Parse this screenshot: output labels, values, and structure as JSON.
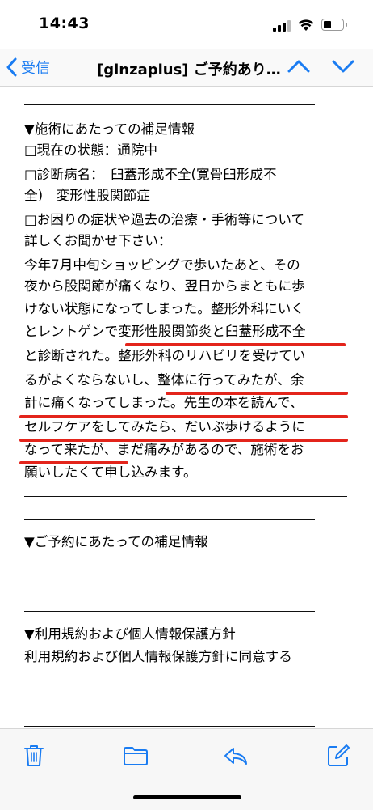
{
  "status_bar": {
    "time": "14:43"
  },
  "nav": {
    "back_label": "受信",
    "title": "[ginzaplus] ご予約あり…"
  },
  "email": {
    "lines": [
      "▼施術にあたっての補足情報",
      "□現在の状態：通院中",
      "□診断病名：　臼蓋形成不全(寛骨臼形成不",
      "全)　変形性股関節症",
      "□お困りの症状や過去の治療・手術等について",
      "詳しくお聞かせ下さい：",
      "今年7月中旬ショッピングで歩いたあと、その",
      "夜から股関節が痛くなり、翌日からまともに歩",
      "けない状態になってしまった。整形外科にいく",
      "とレントゲンで変形性股関節炎と臼蓋形成不全",
      "と診断された。整形外科のリハビリを受けてい",
      "るがよくならないし、整体に行ってみたが、余",
      "計に痛くなってしまった。先生の本を読んで、",
      "セルフケアをしてみたら、だいぶ歩けるように",
      "なって来たが、まだ痛みがあるので、施術をお",
      "願いしたくて申し込みます。",
      "▼ご予約にあたっての補足情報",
      "▼利用規約および個人情報保護方針",
      "利用規約および個人情報保護方針に同意する"
    ]
  },
  "colors": {
    "accent": "#1a7cf2",
    "underline": "#e3241b"
  },
  "icons": [
    "back-chevron-icon",
    "up-arrow-icon",
    "down-arrow-icon",
    "trash-icon",
    "folder-icon",
    "reply-icon",
    "compose-icon",
    "signal-icon",
    "wifi-icon",
    "battery-icon"
  ]
}
